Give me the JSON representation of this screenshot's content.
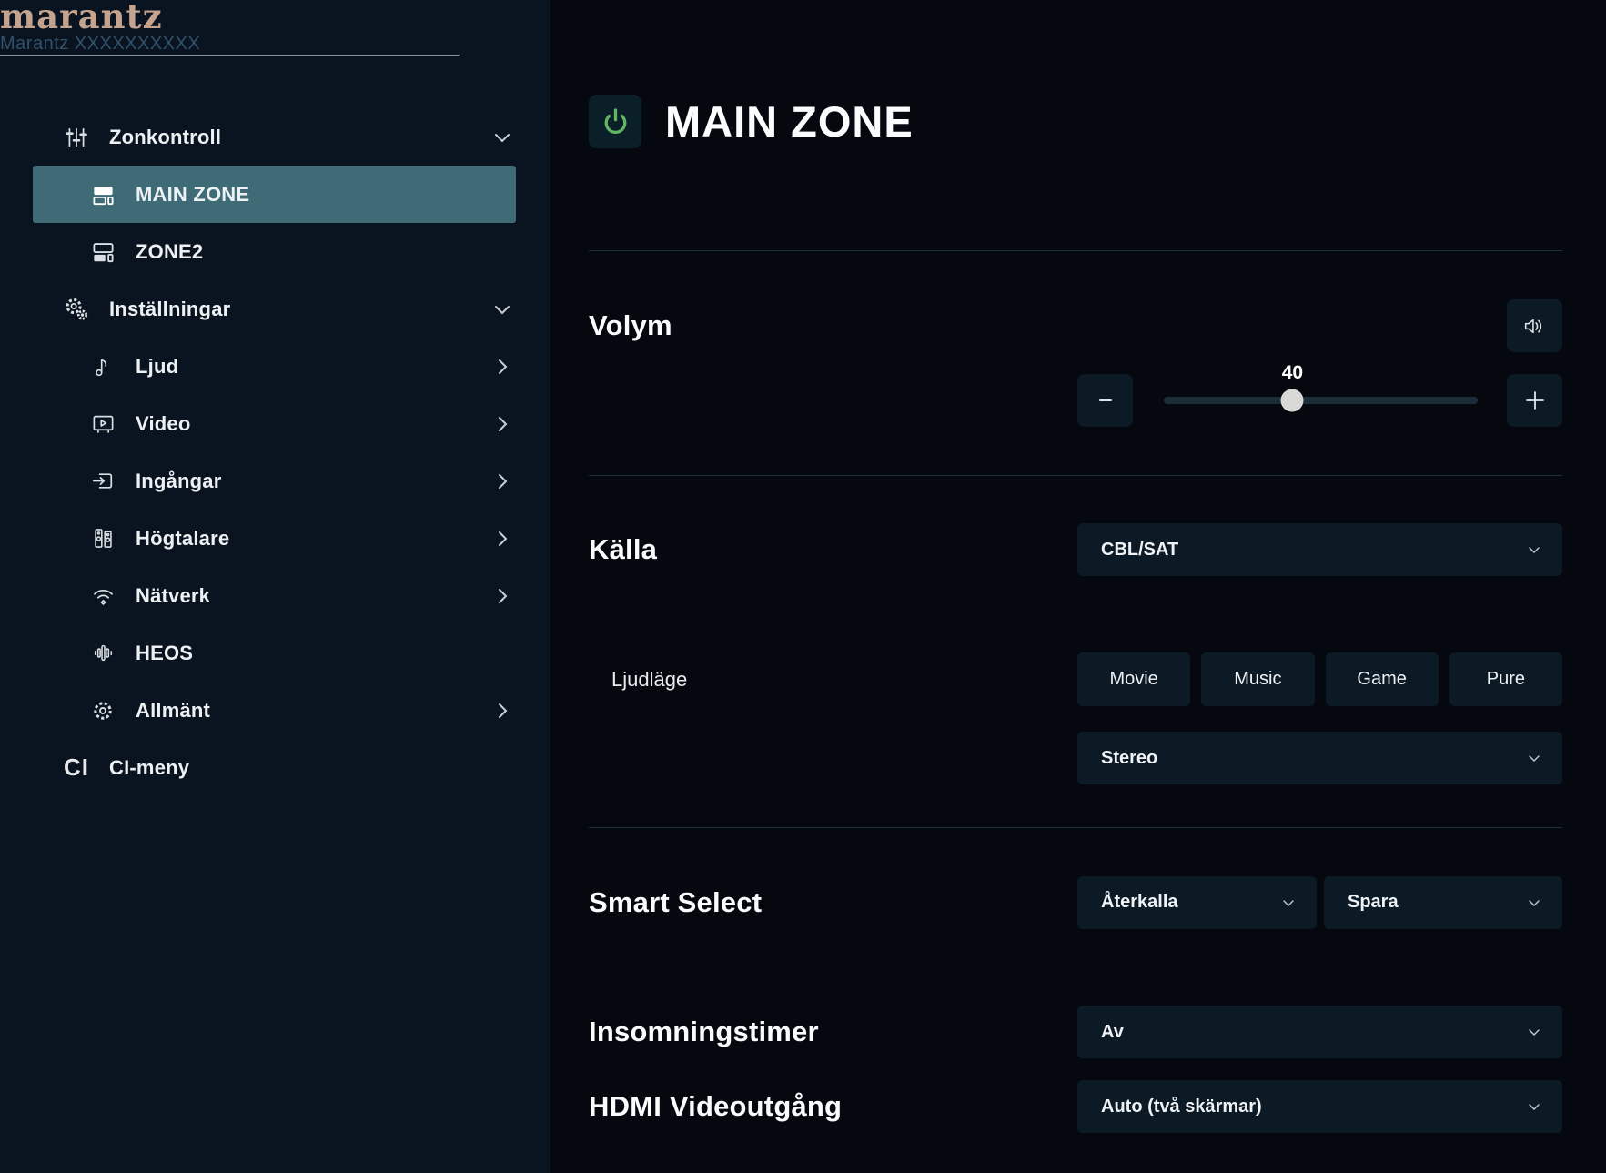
{
  "brand": {
    "logo": "marantz",
    "model": "Marantz XXXXXXXXXX"
  },
  "sidebar": {
    "items": [
      {
        "label": "Zonkontroll",
        "icon": "faders-icon"
      },
      {
        "label": "MAIN ZONE",
        "icon": "main-zone-icon",
        "selected": true
      },
      {
        "label": "ZONE2",
        "icon": "zone2-icon"
      },
      {
        "label": "Inställningar",
        "icon": "gears-icon"
      },
      {
        "label": "Ljud",
        "icon": "music-note-icon"
      },
      {
        "label": "Video",
        "icon": "tv-icon"
      },
      {
        "label": "Ingångar",
        "icon": "input-icon"
      },
      {
        "label": "Högtalare",
        "icon": "speakers-icon"
      },
      {
        "label": "Nätverk",
        "icon": "wifi-icon"
      },
      {
        "label": "HEOS",
        "icon": "heos-icon"
      },
      {
        "label": "Allmänt",
        "icon": "gear-icon"
      },
      {
        "label": "CI-meny",
        "icon": "ci-icon",
        "ci_glyph": "CI"
      }
    ]
  },
  "main": {
    "title": "MAIN ZONE",
    "volume": {
      "label": "Volym",
      "value": "40",
      "percent": 41
    },
    "source": {
      "label": "Källa",
      "value": "CBL/SAT"
    },
    "sound_mode": {
      "label": "Ljudläge",
      "buttons": [
        "Movie",
        "Music",
        "Game",
        "Pure"
      ],
      "selected_mode": "Stereo"
    },
    "smart_select": {
      "label": "Smart Select",
      "recall": "Återkalla",
      "save": "Spara"
    },
    "sleep_timer": {
      "label": "Insomningstimer",
      "value": "Av"
    },
    "hdmi_out": {
      "label": "HDMI Videoutgång",
      "value": "Auto (två skärmar)"
    }
  },
  "colors": {
    "accent": "#3e6b76",
    "logo": "#c4a48f",
    "green": "#63b663",
    "sidebar-bg": "#0a1420",
    "main-bg": "#05090f",
    "card": "#0c1a26"
  }
}
